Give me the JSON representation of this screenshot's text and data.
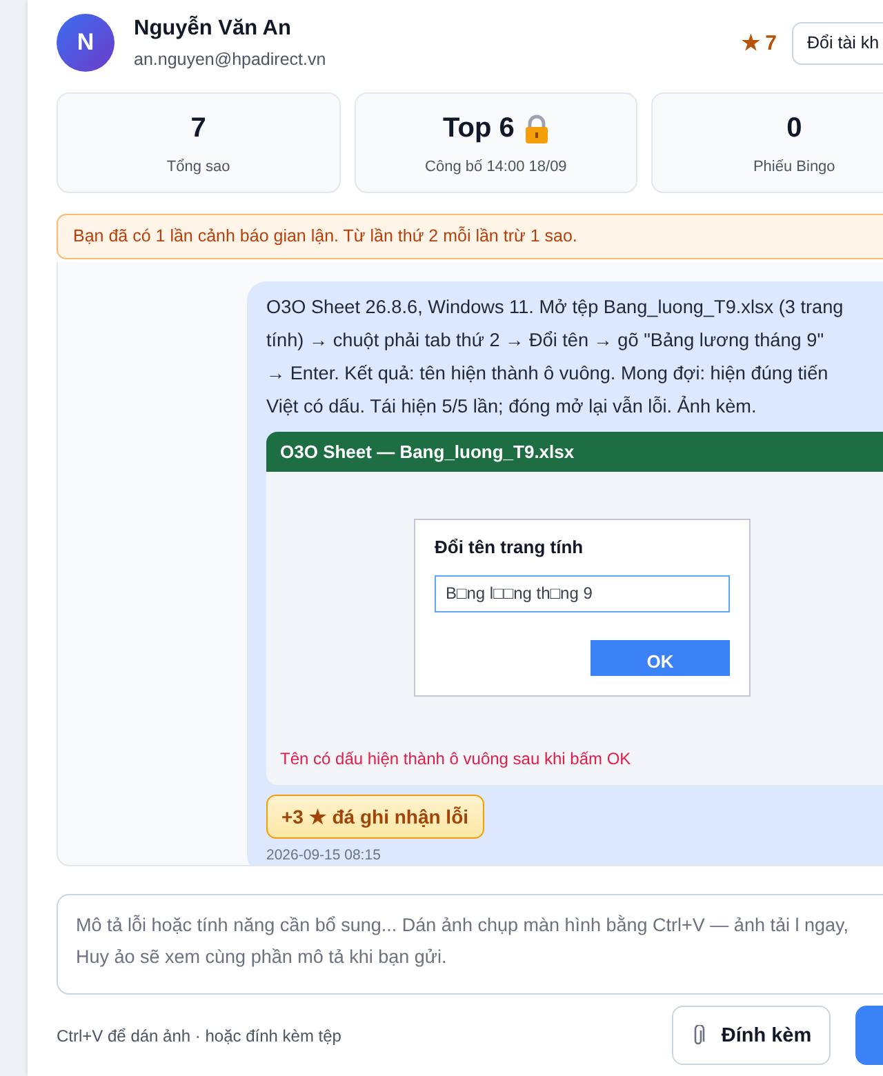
{
  "user": {
    "initial": "N",
    "name": "Nguyễn Văn An",
    "email": "an.nguyen@hpadirect.vn",
    "stars": "★ 7",
    "switch_button": "Đổi tài kh"
  },
  "stats": [
    {
      "value": "7",
      "label": "Tổng sao",
      "locked": false
    },
    {
      "value": "Top 6",
      "label": "Công bố 14:00 18/09",
      "locked": true
    },
    {
      "value": "0",
      "label": "Phiếu Bingo",
      "locked": false
    }
  ],
  "warning": "Bạn đã có 1 lần cảnh báo gian lận. Từ lần thứ 2 mỗi lần trừ 1 sao.",
  "message": {
    "lines": [
      "O3O Sheet 26.8.6, Windows 11. Mở tệp Bang_luong_T9.xlsx (3 trang",
      "tính) → chuột phải tab thứ 2 → Đổi tên → gõ \"Bảng lương tháng 9\"",
      "→ Enter. Kết quả: tên hiện thành ô vuông. Mong đợi: hiện đúng tiến",
      "Việt có dấu. Tái hiện 5/5 lần; đóng mở lại vẫn lỗi. Ảnh kèm."
    ],
    "attachment": {
      "window_title": "O3O Sheet — Bang_luong_T9.xlsx",
      "dialog_title": "Đổi tên trang tính",
      "field_value": "B□ng l□□ng th□ng 9",
      "ok_button": "OK",
      "caption": "Tên có dấu hiện thành ô vuông sau khi bấm OK"
    },
    "reward": "+3 ★ đá ghi nhận lỗi",
    "time": "2026-09-15 08:15"
  },
  "composer": {
    "placeholder": "Mô tả lỗi hoặc tính năng cần bổ sung... Dán ảnh chụp màn hình bằng Ctrl+V — ảnh tải l ngay, Huy ảo sẽ xem cùng phần mô tả khi bạn gửi.",
    "hint": "Ctrl+V để dán ảnh · hoặc đính kèm tệp",
    "attach_button": "Đính kèm"
  }
}
